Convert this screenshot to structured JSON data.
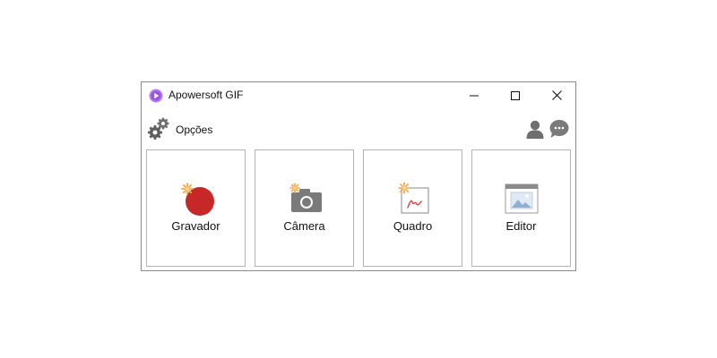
{
  "window": {
    "title": "Apowersoft GIF"
  },
  "toolbar": {
    "options_label": "Opções"
  },
  "tiles": [
    {
      "label": "Gravador",
      "icon": "record-icon"
    },
    {
      "label": "Câmera",
      "icon": "camera-icon"
    },
    {
      "label": "Quadro",
      "icon": "whiteboard-icon"
    },
    {
      "label": "Editor",
      "icon": "editor-icon"
    }
  ],
  "colors": {
    "record_red": "#c62828",
    "spark_orange": "#f4a742",
    "gray_icon": "#7a7a7a",
    "app_purple": "#a45ee5"
  }
}
